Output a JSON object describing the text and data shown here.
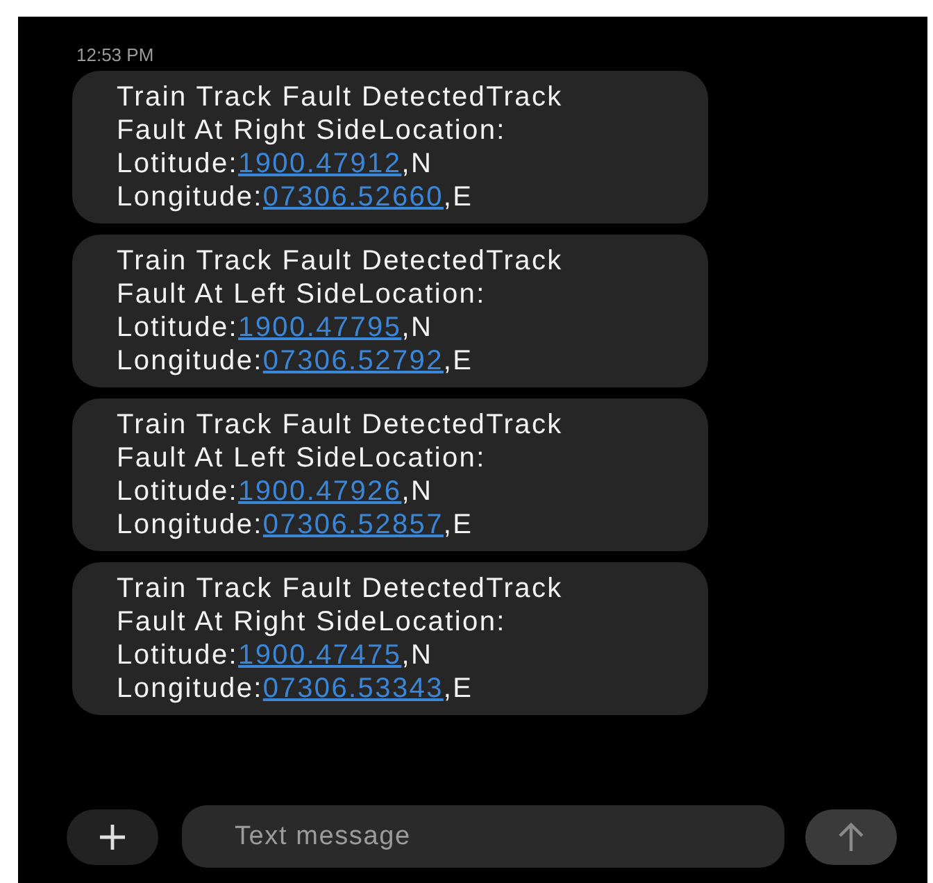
{
  "timestamp": "12:53 PM",
  "messages": [
    {
      "text": "Train Track Fault DetectedTrack Fault At Right SideLocation:",
      "latitude_label": "Lotitude:",
      "latitude": "1900.47912",
      "latitude_suffix": ",N",
      "longitude_label": "Longitude:",
      "longitude": "07306.52660",
      "longitude_suffix": ",E"
    },
    {
      "text": "Train Track Fault DetectedTrack Fault At Left SideLocation:",
      "latitude_label": "Lotitude:",
      "latitude": "1900.47795",
      "latitude_suffix": ",N",
      "longitude_label": "Longitude:",
      "longitude": "07306.52792",
      "longitude_suffix": ",E"
    },
    {
      "text": "Train Track Fault DetectedTrack Fault At Left SideLocation:",
      "latitude_label": "Lotitude:",
      "latitude": "1900.47926",
      "latitude_suffix": ",N",
      "longitude_label": "Longitude:",
      "longitude": "07306.52857",
      "longitude_suffix": ",E"
    },
    {
      "text": "Train Track Fault DetectedTrack Fault At Right SideLocation:",
      "latitude_label": "Lotitude:",
      "latitude": "1900.47475",
      "latitude_suffix": ",N",
      "longitude_label": "Longitude:",
      "longitude": "07306.53343",
      "longitude_suffix": ",E"
    }
  ],
  "composer": {
    "placeholder": "Text message"
  }
}
